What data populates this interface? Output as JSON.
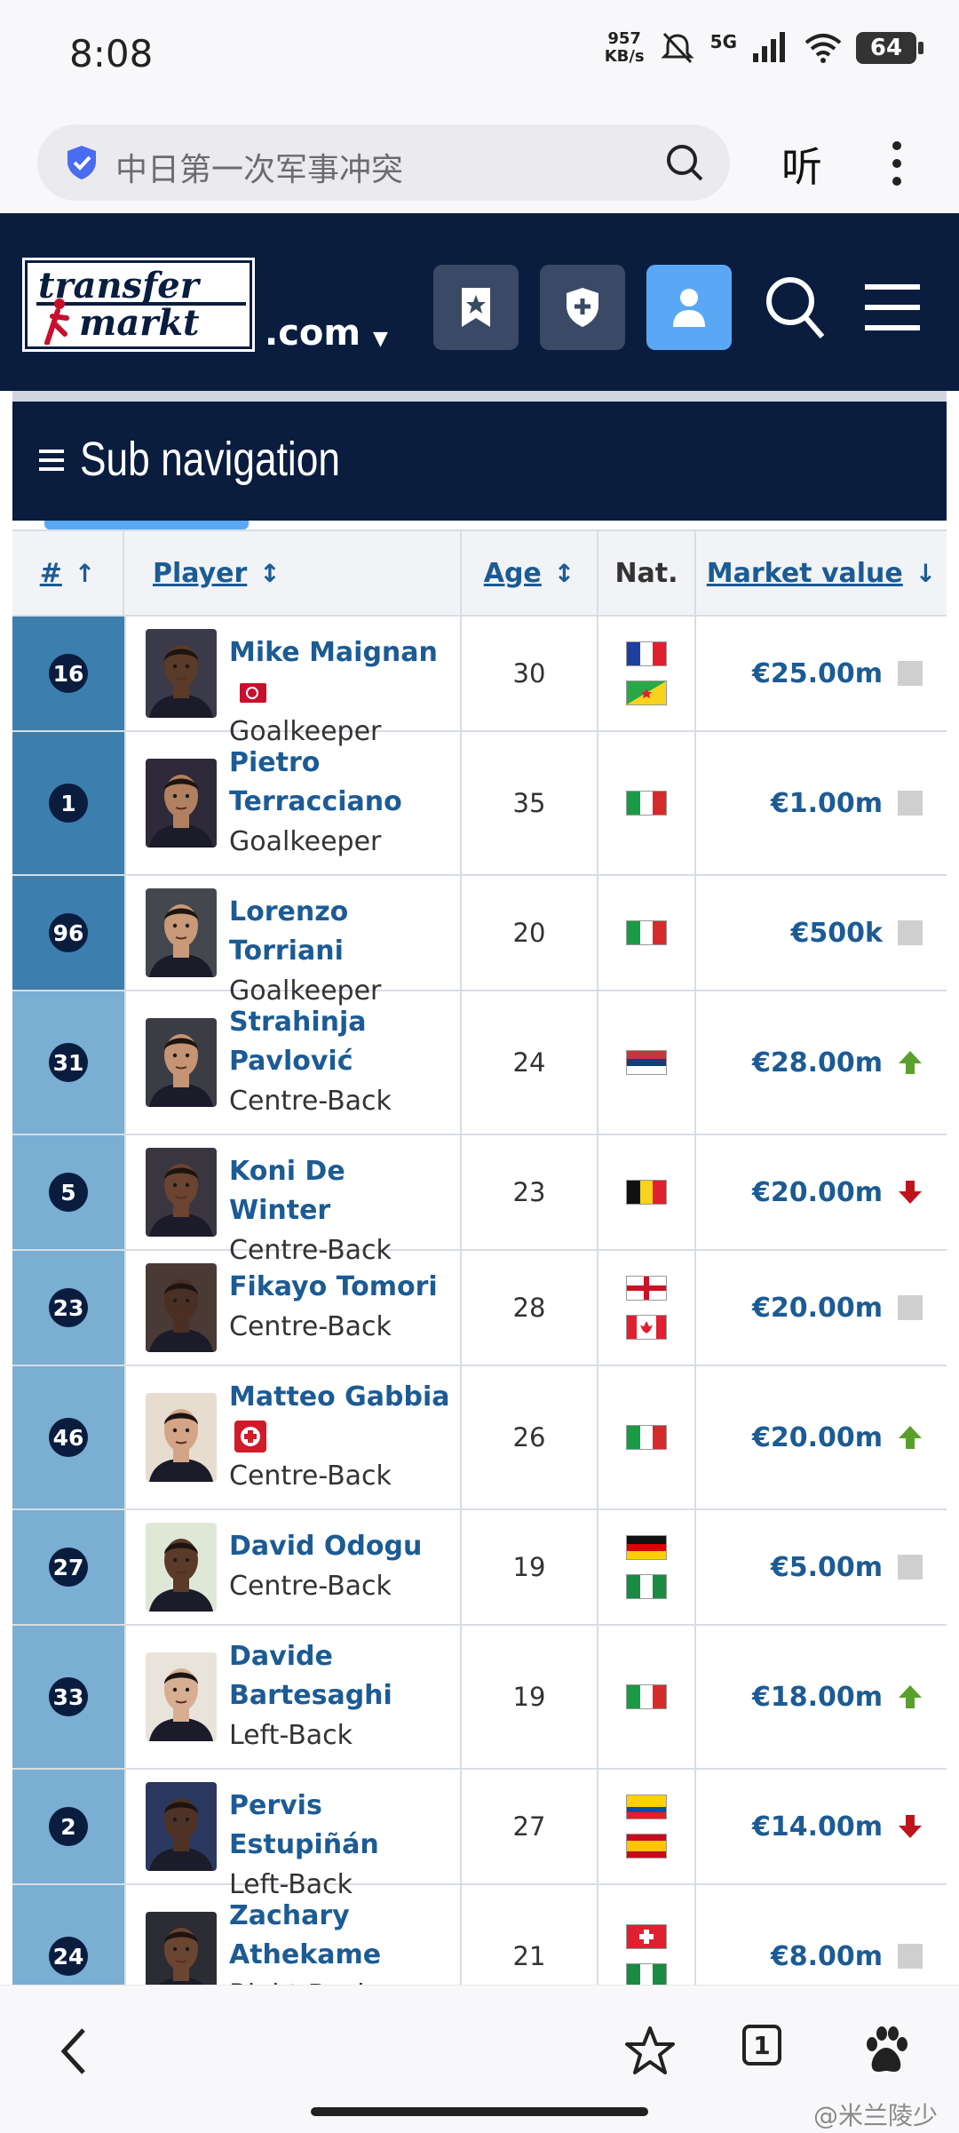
{
  "status_bar": {
    "time": "8:08",
    "speed_value": "957",
    "speed_unit": "KB/s",
    "network": "5G",
    "battery": "64"
  },
  "browser": {
    "search_text": "中日第一次军事冲突",
    "listen_label": "听"
  },
  "site": {
    "logo_line1": "transfer",
    "logo_line2": "markt",
    "domain": ".com"
  },
  "subnav": {
    "label": "Sub navigation"
  },
  "table": {
    "headers": {
      "num": "#",
      "player": "Player",
      "age": "Age",
      "nat": "Nat.",
      "market_value": "Market value"
    },
    "rows": [
      {
        "num": "16",
        "name_lines": [
          "Mike Maignan"
        ],
        "position": "Goalkeeper",
        "age": "30",
        "flags": [
          "france",
          "french-guiana"
        ],
        "value": "€25.00m",
        "trend": "none",
        "captain": true,
        "injury": false,
        "skin": "#5a3a28"
      },
      {
        "num": "1",
        "name_lines": [
          "Pietro",
          "Terracciano"
        ],
        "position": "Goalkeeper",
        "age": "35",
        "flags": [
          "italy"
        ],
        "value": "€1.00m",
        "trend": "none",
        "captain": false,
        "injury": false,
        "skin": "#b08060"
      },
      {
        "num": "96",
        "name_lines": [
          "Lorenzo Torriani"
        ],
        "position": "Goalkeeper",
        "age": "20",
        "flags": [
          "italy"
        ],
        "value": "€500k",
        "trend": "none",
        "captain": false,
        "injury": false,
        "skin": "#c89a78"
      },
      {
        "num": "31",
        "name_lines": [
          "Strahinja",
          "Pavlović"
        ],
        "position": "Centre-Back",
        "age": "24",
        "flags": [
          "serbia"
        ],
        "value": "€28.00m",
        "trend": "up",
        "captain": false,
        "injury": false,
        "skin": "#c49474"
      },
      {
        "num": "5",
        "name_lines": [
          "Koni De Winter"
        ],
        "position": "Centre-Back",
        "age": "23",
        "flags": [
          "belgium"
        ],
        "value": "€20.00m",
        "trend": "down",
        "captain": false,
        "injury": false,
        "skin": "#6a4430"
      },
      {
        "num": "23",
        "name_lines": [
          "Fikayo Tomori"
        ],
        "position": "Centre-Back",
        "age": "28",
        "flags": [
          "england",
          "canada"
        ],
        "value": "€20.00m",
        "trend": "none",
        "captain": false,
        "injury": false,
        "skin": "#4a3024"
      },
      {
        "num": "46",
        "name_lines": [
          "Matteo Gabbia"
        ],
        "position": "Centre-Back",
        "age": "26",
        "flags": [
          "italy"
        ],
        "value": "€20.00m",
        "trend": "up",
        "captain": false,
        "injury": true,
        "skin": "#d4a486"
      },
      {
        "num": "27",
        "name_lines": [
          "David Odogu"
        ],
        "position": "Centre-Back",
        "age": "19",
        "flags": [
          "germany",
          "nigeria"
        ],
        "value": "€5.00m",
        "trend": "none",
        "captain": false,
        "injury": false,
        "skin": "#5a3a28"
      },
      {
        "num": "33",
        "name_lines": [
          "Davide",
          "Bartesaghi"
        ],
        "position": "Left-Back",
        "age": "19",
        "flags": [
          "italy"
        ],
        "value": "€18.00m",
        "trend": "up",
        "captain": false,
        "injury": false,
        "skin": "#d8ae92"
      },
      {
        "num": "2",
        "name_lines": [
          "Pervis Estupiñán"
        ],
        "position": "Left-Back",
        "age": "27",
        "flags": [
          "ecuador",
          "spain"
        ],
        "value": "€14.00m",
        "trend": "down",
        "captain": false,
        "injury": false,
        "skin": "#4e3226"
      },
      {
        "num": "24",
        "name_lines": [
          "Zachary",
          "Athekame"
        ],
        "position": "Right-Back",
        "age": "21",
        "flags": [
          "switzerland",
          "nigeria"
        ],
        "value": "€8.00m",
        "trend": "none",
        "captain": false,
        "injury": false,
        "skin": "#6a4632"
      }
    ]
  },
  "bottom_bar": {
    "tab_count": "1",
    "watermark": "@米兰陵少"
  },
  "colors": {
    "header_bg": "#0a1d3f",
    "link": "#1c5b94",
    "gk_band": "#3c7fae",
    "def_band": "#7aaed2",
    "up": "#5aa02c",
    "down": "#c0141c"
  }
}
